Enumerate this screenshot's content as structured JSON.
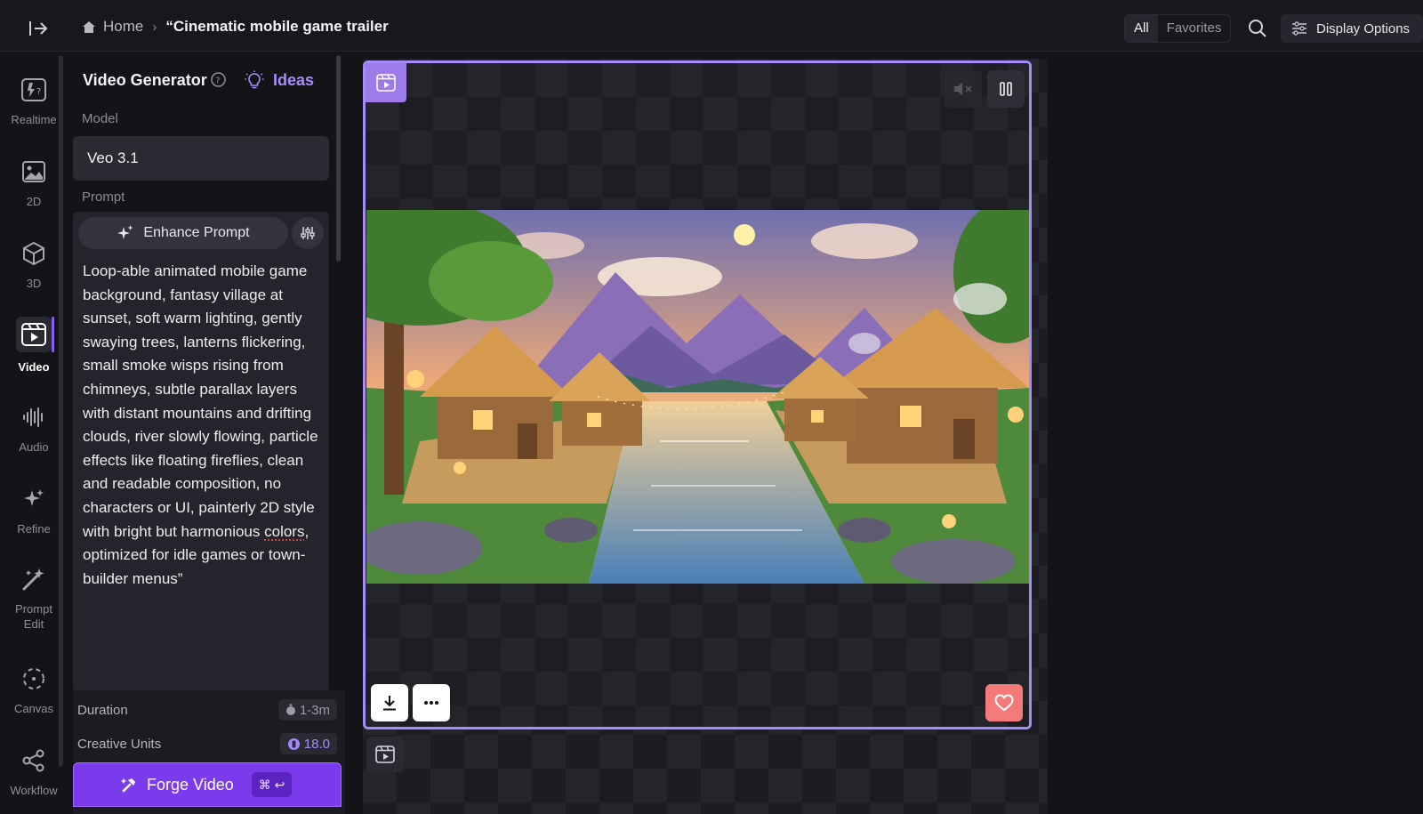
{
  "header": {
    "breadcrumb_home": "Home",
    "breadcrumb_separator": "›",
    "breadcrumb_current": "“Cinematic mobile game trailer",
    "filter_all": "All",
    "filter_favorites": "Favorites",
    "display_options": "Display Options"
  },
  "rail": {
    "items": [
      {
        "label": "Realtime",
        "icon": "realtime-icon"
      },
      {
        "label": "2D",
        "icon": "image-icon"
      },
      {
        "label": "3D",
        "icon": "cube-icon"
      },
      {
        "label": "Video",
        "icon": "video-icon",
        "active": true
      },
      {
        "label": "Audio",
        "icon": "waveform-icon"
      },
      {
        "label": "Refine",
        "icon": "sparkle-icon"
      },
      {
        "label": "Prompt Edit",
        "icon": "magic-wand-icon"
      },
      {
        "label": "Canvas",
        "icon": "canvas-icon"
      },
      {
        "label": "Workflow",
        "icon": "share-nodes-icon"
      }
    ]
  },
  "panel": {
    "title": "Video Generator",
    "ideas_label": "Ideas",
    "model_label": "Model",
    "model_value": "Veo 3.1",
    "prompt_label": "Prompt",
    "enhance_label": "Enhance Prompt",
    "prompt_text_before": "Loop-able animated mobile game background, fantasy village at sunset, soft warm lighting, gently swaying trees, lanterns flickering, small smoke wisps rising from chimneys, subtle parallax layers with distant mountains and drifting clouds, river slowly flowing, particle effects like floating fireflies, clean and readable composition, no characters or UI, painterly 2D style with bright but harmonious ",
    "prompt_text_misspelled": "colors",
    "prompt_text_after": ", optimized for idle games or town-builder menus”",
    "duration_label": "Duration",
    "duration_value": "1-3m",
    "units_label": "Creative Units",
    "units_value": "18.0",
    "forge_label": "Forge Video",
    "forge_shortcut": "⌘ ↩"
  },
  "colors": {
    "accent": "#8b5cf6",
    "card_border": "#a78bfa",
    "favorite": "#f47a7a",
    "background": "#141418"
  }
}
